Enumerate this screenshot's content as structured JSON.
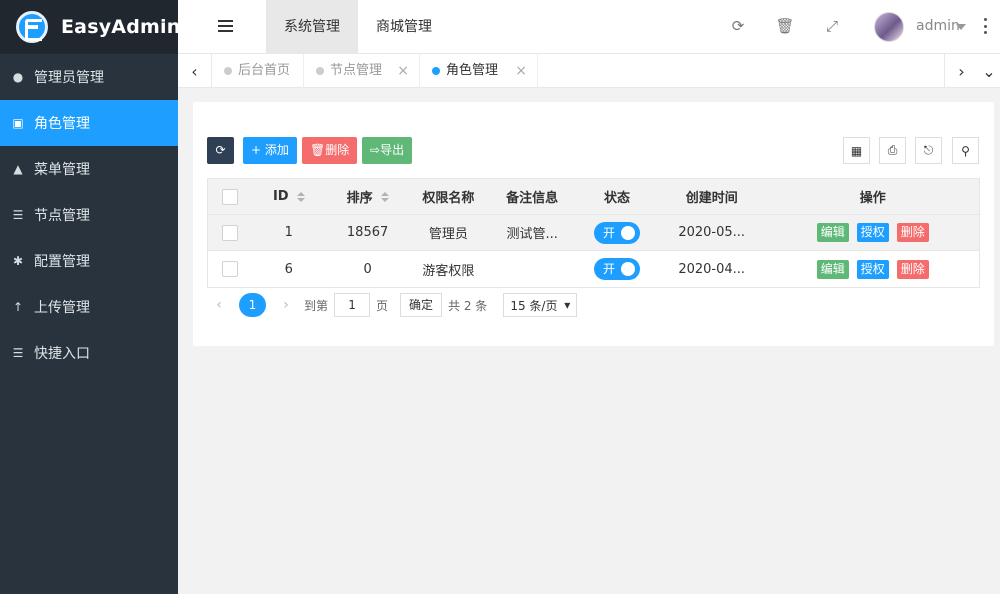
{
  "app": {
    "name": "EasyAdmin"
  },
  "sidebar": {
    "items": [
      {
        "label": "管理员管理",
        "icon": "user-icon"
      },
      {
        "label": "角色管理",
        "icon": "role-icon",
        "active": true
      },
      {
        "label": "菜单管理",
        "icon": "tree-icon"
      },
      {
        "label": "节点管理",
        "icon": "list-icon"
      },
      {
        "label": "配置管理",
        "icon": "gear-icon"
      },
      {
        "label": "上传管理",
        "icon": "upload-arrow-icon"
      },
      {
        "label": "快捷入口",
        "icon": "list-icon"
      }
    ]
  },
  "header": {
    "tabs": [
      {
        "label": "系统管理",
        "active": true
      },
      {
        "label": "商城管理"
      }
    ],
    "user": "admin",
    "icons": [
      "refresh-icon",
      "trash-icon",
      "fullscreen-icon",
      "more-icon"
    ]
  },
  "tabbar": {
    "tabs": [
      {
        "label": "后台首页",
        "closable": false
      },
      {
        "label": "节点管理",
        "closable": true
      },
      {
        "label": "角色管理",
        "closable": true,
        "active": true
      }
    ]
  },
  "toolbar": {
    "add": "添加",
    "delete": "删除",
    "export": "导出"
  },
  "table": {
    "columns": {
      "id": "ID",
      "sort": "排序",
      "name": "权限名称",
      "remark": "备注信息",
      "status": "状态",
      "created": "创建时间",
      "ops": "操作"
    },
    "rows": [
      {
        "id": "1",
        "sort": "18567",
        "name": "管理员",
        "remark": "测试管...",
        "status": "开",
        "created": "2020-05...",
        "edit": "编辑",
        "auth": "授权",
        "del": "删除"
      },
      {
        "id": "6",
        "sort": "0",
        "name": "游客权限",
        "remark": "",
        "status": "开",
        "created": "2020-04...",
        "edit": "编辑",
        "auth": "授权",
        "del": "删除"
      }
    ]
  },
  "pager": {
    "current": "1",
    "goto_prefix": "到第",
    "goto_value": "1",
    "goto_suffix": "页",
    "confirm": "确定",
    "total": "共 2 条",
    "page_size": "15 条/页"
  },
  "colors": {
    "primary": "#1e9fff",
    "sidebar": "#28333e",
    "success": "#5fb878",
    "danger": "#f56c6c",
    "dark": "#2f4056"
  }
}
